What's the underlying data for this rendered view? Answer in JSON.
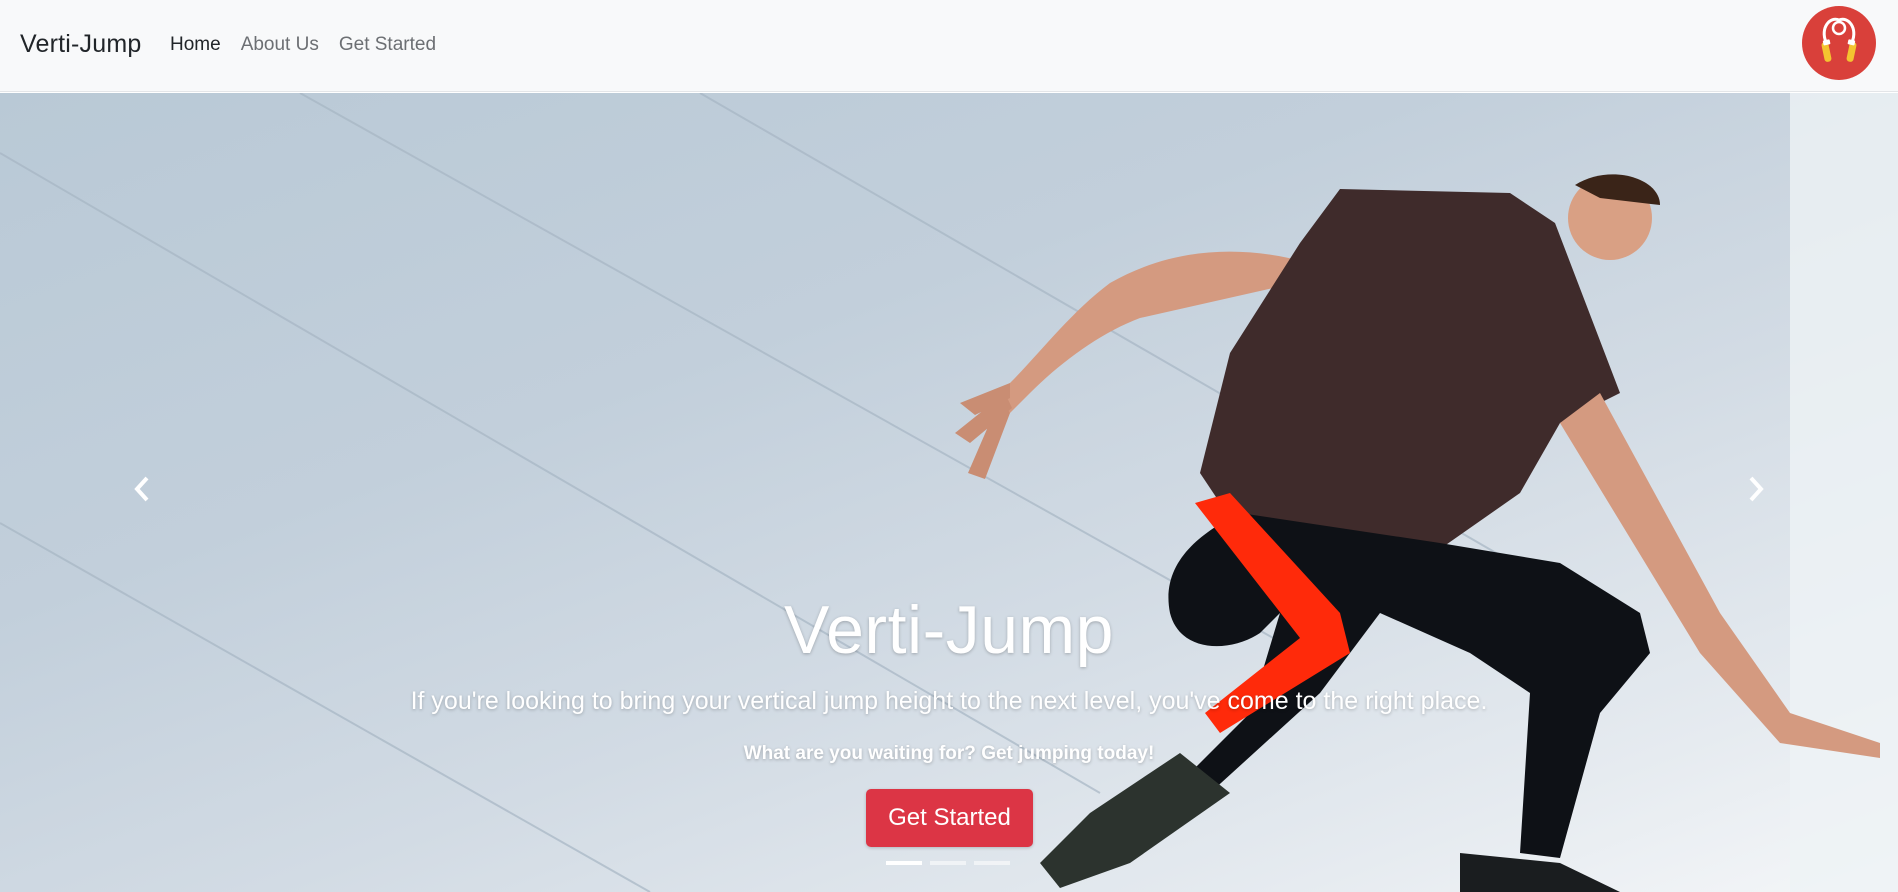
{
  "navbar": {
    "brand": "Verti-Jump",
    "links": [
      "Home",
      "About Us",
      "Get Started"
    ],
    "active_index": 0,
    "logo_icon": "jump-rope-icon",
    "logo_color": "#d9403a"
  },
  "hero": {
    "title": "Verti-Jump",
    "subtitle": "If you're looking to bring your vertical jump height to the next level, you've come to the right place.",
    "note": "What are you waiting for? Get jumping today!",
    "cta_label": "Get Started",
    "cta_color": "#dc3545",
    "prev_icon": "chevron-left-icon",
    "next_icon": "chevron-right-icon",
    "slide_count": 3,
    "active_slide": 1
  }
}
